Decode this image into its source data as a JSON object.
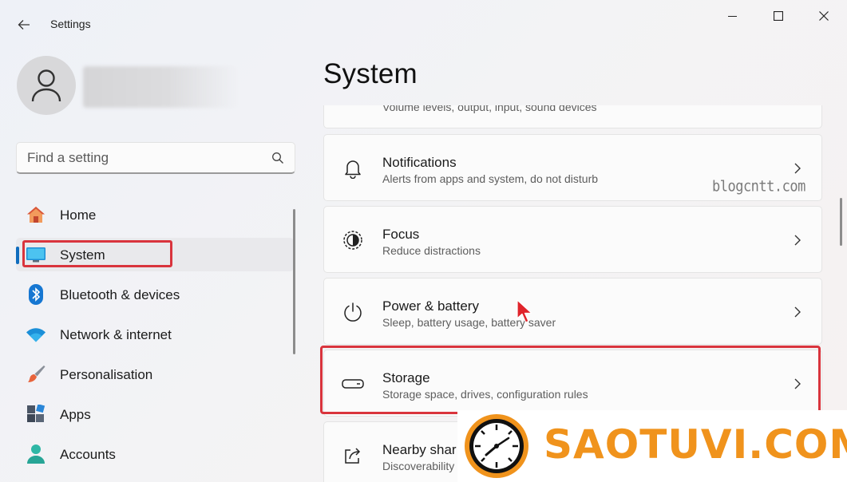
{
  "window": {
    "title": "Settings",
    "controls": {
      "minimize": "minimize-icon",
      "maximize": "maximize-icon",
      "close": "close-icon"
    }
  },
  "search": {
    "placeholder": "Find a setting"
  },
  "sidebar": {
    "items": [
      {
        "label": "Home",
        "icon": "home-icon",
        "selected": false
      },
      {
        "label": "System",
        "icon": "monitor-icon",
        "selected": true
      },
      {
        "label": "Bluetooth & devices",
        "icon": "bluetooth-icon",
        "selected": false
      },
      {
        "label": "Network & internet",
        "icon": "wifi-icon",
        "selected": false
      },
      {
        "label": "Personalisation",
        "icon": "paintbrush-icon",
        "selected": false
      },
      {
        "label": "Apps",
        "icon": "apps-icon",
        "selected": false
      },
      {
        "label": "Accounts",
        "icon": "account-icon",
        "selected": false
      }
    ]
  },
  "main": {
    "title": "System",
    "cards": [
      {
        "title": "",
        "subtitle": "Volume levels, output, input, sound devices",
        "icon": ""
      },
      {
        "title": "Notifications",
        "subtitle": "Alerts from apps and system, do not disturb",
        "icon": "bell-icon"
      },
      {
        "title": "Focus",
        "subtitle": "Reduce distractions",
        "icon": "focus-icon"
      },
      {
        "title": "Power & battery",
        "subtitle": "Sleep, battery usage, battery saver",
        "icon": "power-icon"
      },
      {
        "title": "Storage",
        "subtitle": "Storage space, drives, configuration rules",
        "icon": "storage-icon"
      },
      {
        "title": "Nearby shar",
        "subtitle": "Discoverability",
        "icon": "share-icon"
      }
    ]
  },
  "watermark": "blogcntt.com",
  "brand": {
    "text": "SAOTUVI.COM"
  },
  "colors": {
    "accent": "#0f6cbd",
    "highlight": "#d9343d",
    "brand": "#f0931c"
  }
}
